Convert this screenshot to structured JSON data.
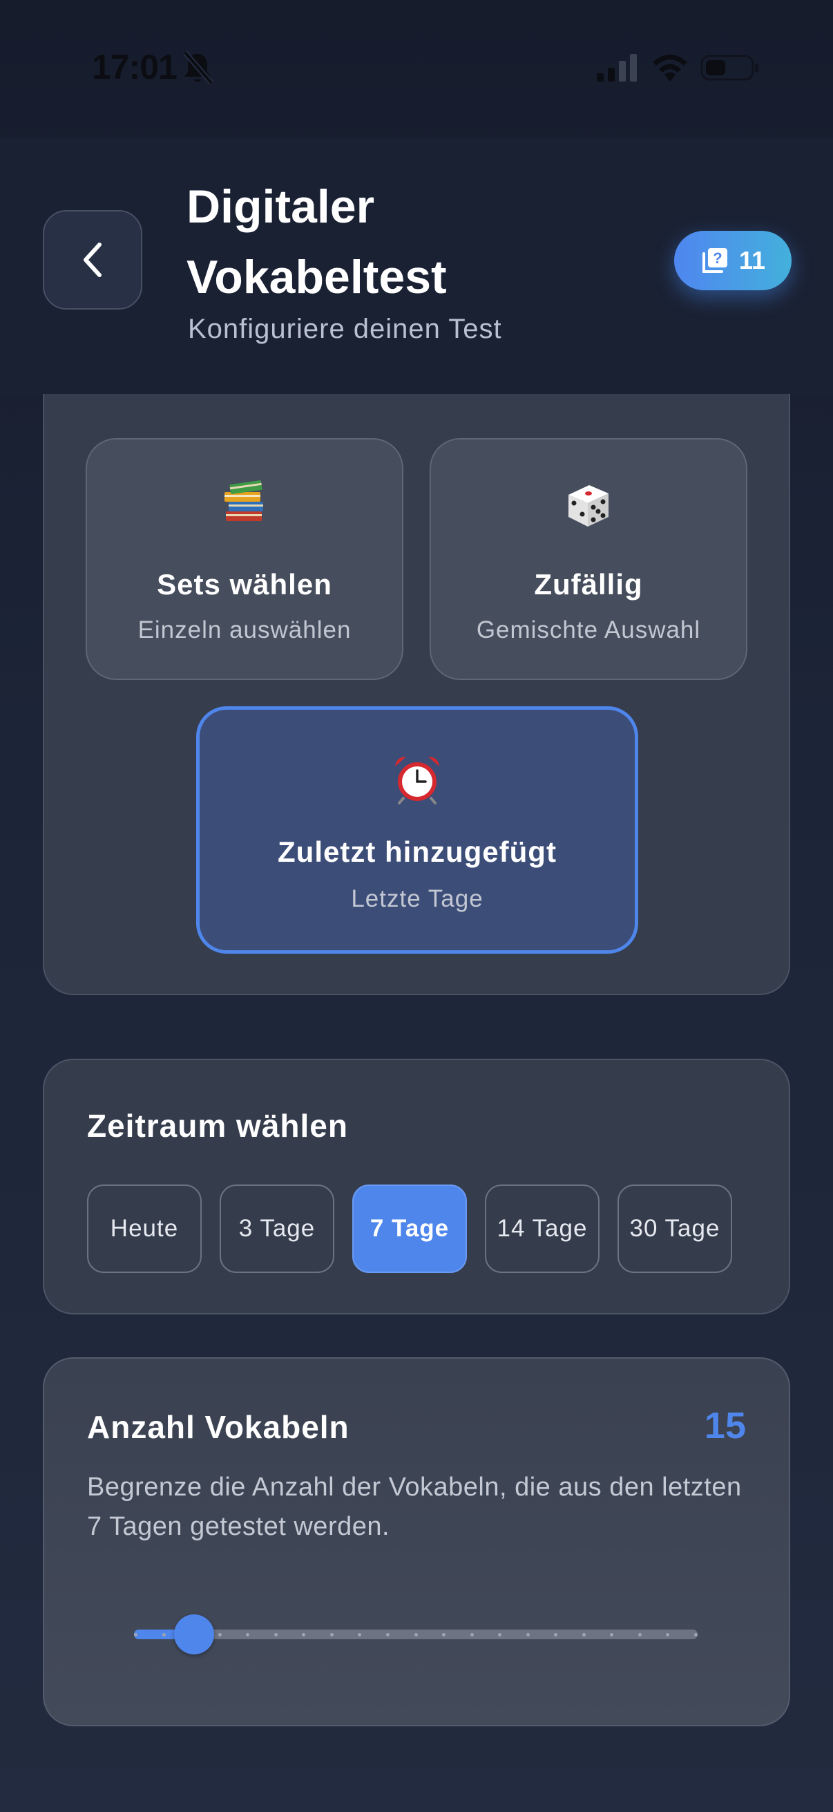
{
  "status_bar": {
    "time": "17:01",
    "mute_icon": "bell-slash-icon",
    "signal_icon": "cellular-signal-icon",
    "wifi_icon": "wifi-icon",
    "battery_icon": "battery-low-icon"
  },
  "header": {
    "back_icon": "chevron-left-icon",
    "title": "Digitaler Vokabeltest",
    "subtitle": "Konfiguriere deinen Test",
    "badge": {
      "icon": "question-cards-icon",
      "count": "11"
    }
  },
  "modes": [
    {
      "emoji": "📚",
      "title": "Sets wählen",
      "subtitle": "Einzeln auswählen",
      "selected": false
    },
    {
      "emoji": "🎲",
      "title": "Zufällig",
      "subtitle": "Gemischte Auswahl",
      "selected": false
    },
    {
      "emoji": "⏰",
      "title": "Zuletzt hinzugefügt",
      "subtitle": "Letzte Tage",
      "selected": true
    }
  ],
  "period": {
    "title": "Zeitraum wählen",
    "options": [
      "Heute",
      "3 Tage",
      "7 Tage",
      "14 Tage",
      "30 Tage"
    ],
    "selected": "7 Tage"
  },
  "count": {
    "title": "Anzahl Vokabeln",
    "value": "15",
    "description": "Begrenze die Anzahl der Vokabeln, die aus den letzten 7 Tagen getestet werden.",
    "slider_fraction": 0.107,
    "slider_steps": 20
  },
  "colors": {
    "accent": "#4f86ec",
    "background": "#1c2437",
    "card": "#363d4d"
  }
}
